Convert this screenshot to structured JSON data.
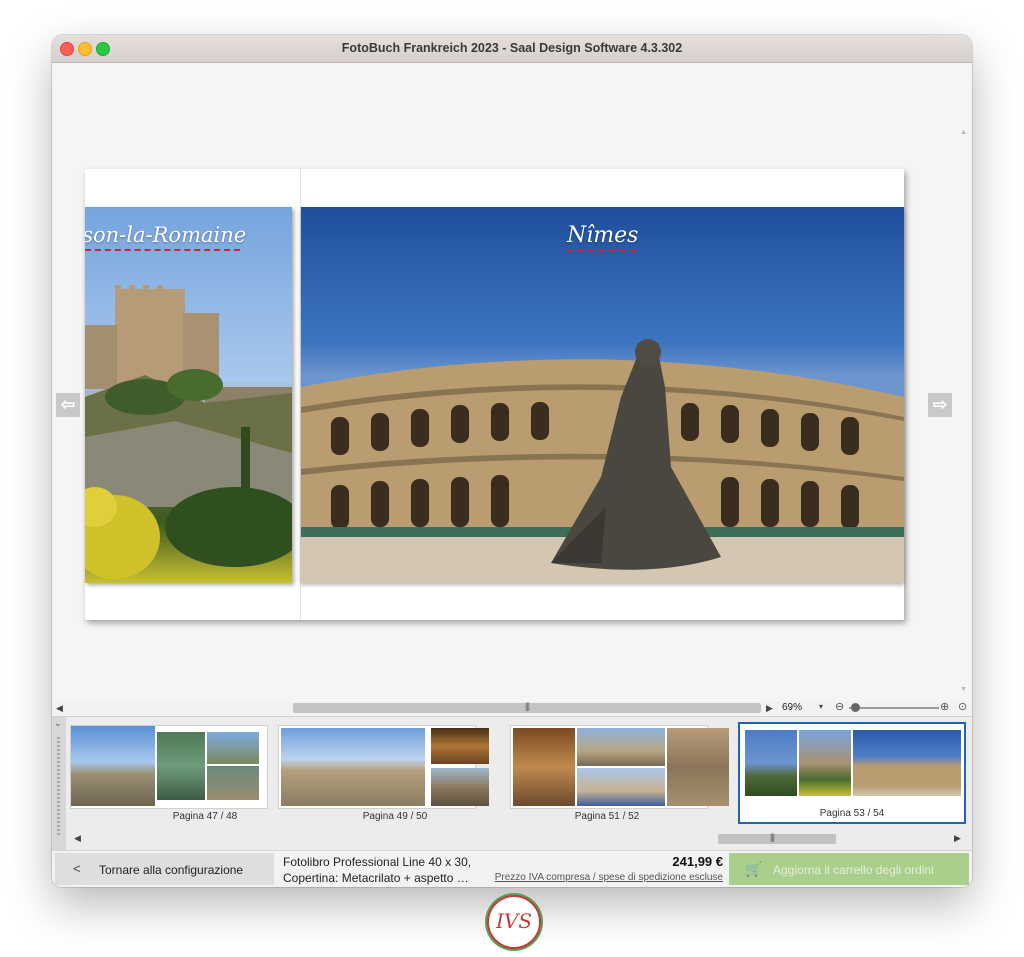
{
  "window": {
    "title": "FotoBuch Frankreich 2023 - Saal Design Software 4.3.302"
  },
  "spread": {
    "left_title": "aison-la-Romaine",
    "main_title": "Nîmes"
  },
  "zoom": {
    "value": "69%"
  },
  "thumbnails": [
    {
      "label": "Pagina 47 / 48",
      "selected": false
    },
    {
      "label": "Pagina 49 / 50",
      "selected": false
    },
    {
      "label": "Pagina 51 / 52",
      "selected": false
    },
    {
      "label": "Pagina 53 / 54",
      "selected": true
    }
  ],
  "footer": {
    "back_label": "Tornare alla configurazione",
    "product_line1": "Fotolibro Professional Line 40 x 30,",
    "product_line2": "Copertina: Metacrilato + aspetto …",
    "price": "241,99 €",
    "price_note": "Prezzo IVA compresa / spese di spedizione escluse",
    "cart_label": "Aggiorna il carrello degli ordini"
  },
  "watermark": {
    "text": "IVS"
  },
  "icons": [
    "arrow-left-icon",
    "arrow-right-icon",
    "zoom-out-icon",
    "zoom-in-icon",
    "zoom-fit-icon",
    "chevron-left-icon",
    "cart-icon"
  ],
  "colors": {
    "accent": "#1f64b5",
    "cart_button": "#a9cf8a",
    "title_underline": "#d3252b"
  }
}
